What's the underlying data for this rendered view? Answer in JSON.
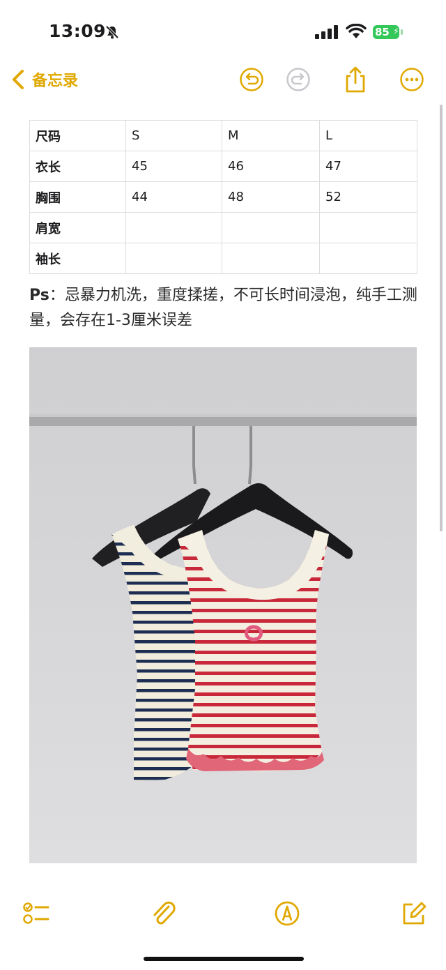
{
  "status_bar": {
    "time": "13:09",
    "battery": "85"
  },
  "nav": {
    "back_label": "备忘录"
  },
  "size_table": {
    "rows": [
      [
        "尺码",
        "S",
        "M",
        "L"
      ],
      [
        "衣长",
        "45",
        "46",
        "47"
      ],
      [
        "胸围",
        "44",
        "48",
        "52"
      ],
      [
        "肩宽",
        "",
        "",
        ""
      ],
      [
        "袖长",
        "",
        "",
        ""
      ]
    ]
  },
  "note": {
    "prefix": "Ps",
    "text": "：忌暴力机洗，重度揉搓，不可长时间浸泡，纯手工测量，会存在1-3厘米误差"
  },
  "colors": {
    "accent": "#e0a800",
    "red_stripe": "#c8283a",
    "navy_stripe": "#1e2e52"
  },
  "icons": {
    "nav": [
      "chevron-left-icon",
      "undo-icon",
      "redo-icon",
      "share-icon",
      "more-icon"
    ],
    "toolbar": [
      "checklist-icon",
      "attachment-icon",
      "markup-icon",
      "compose-icon"
    ]
  }
}
